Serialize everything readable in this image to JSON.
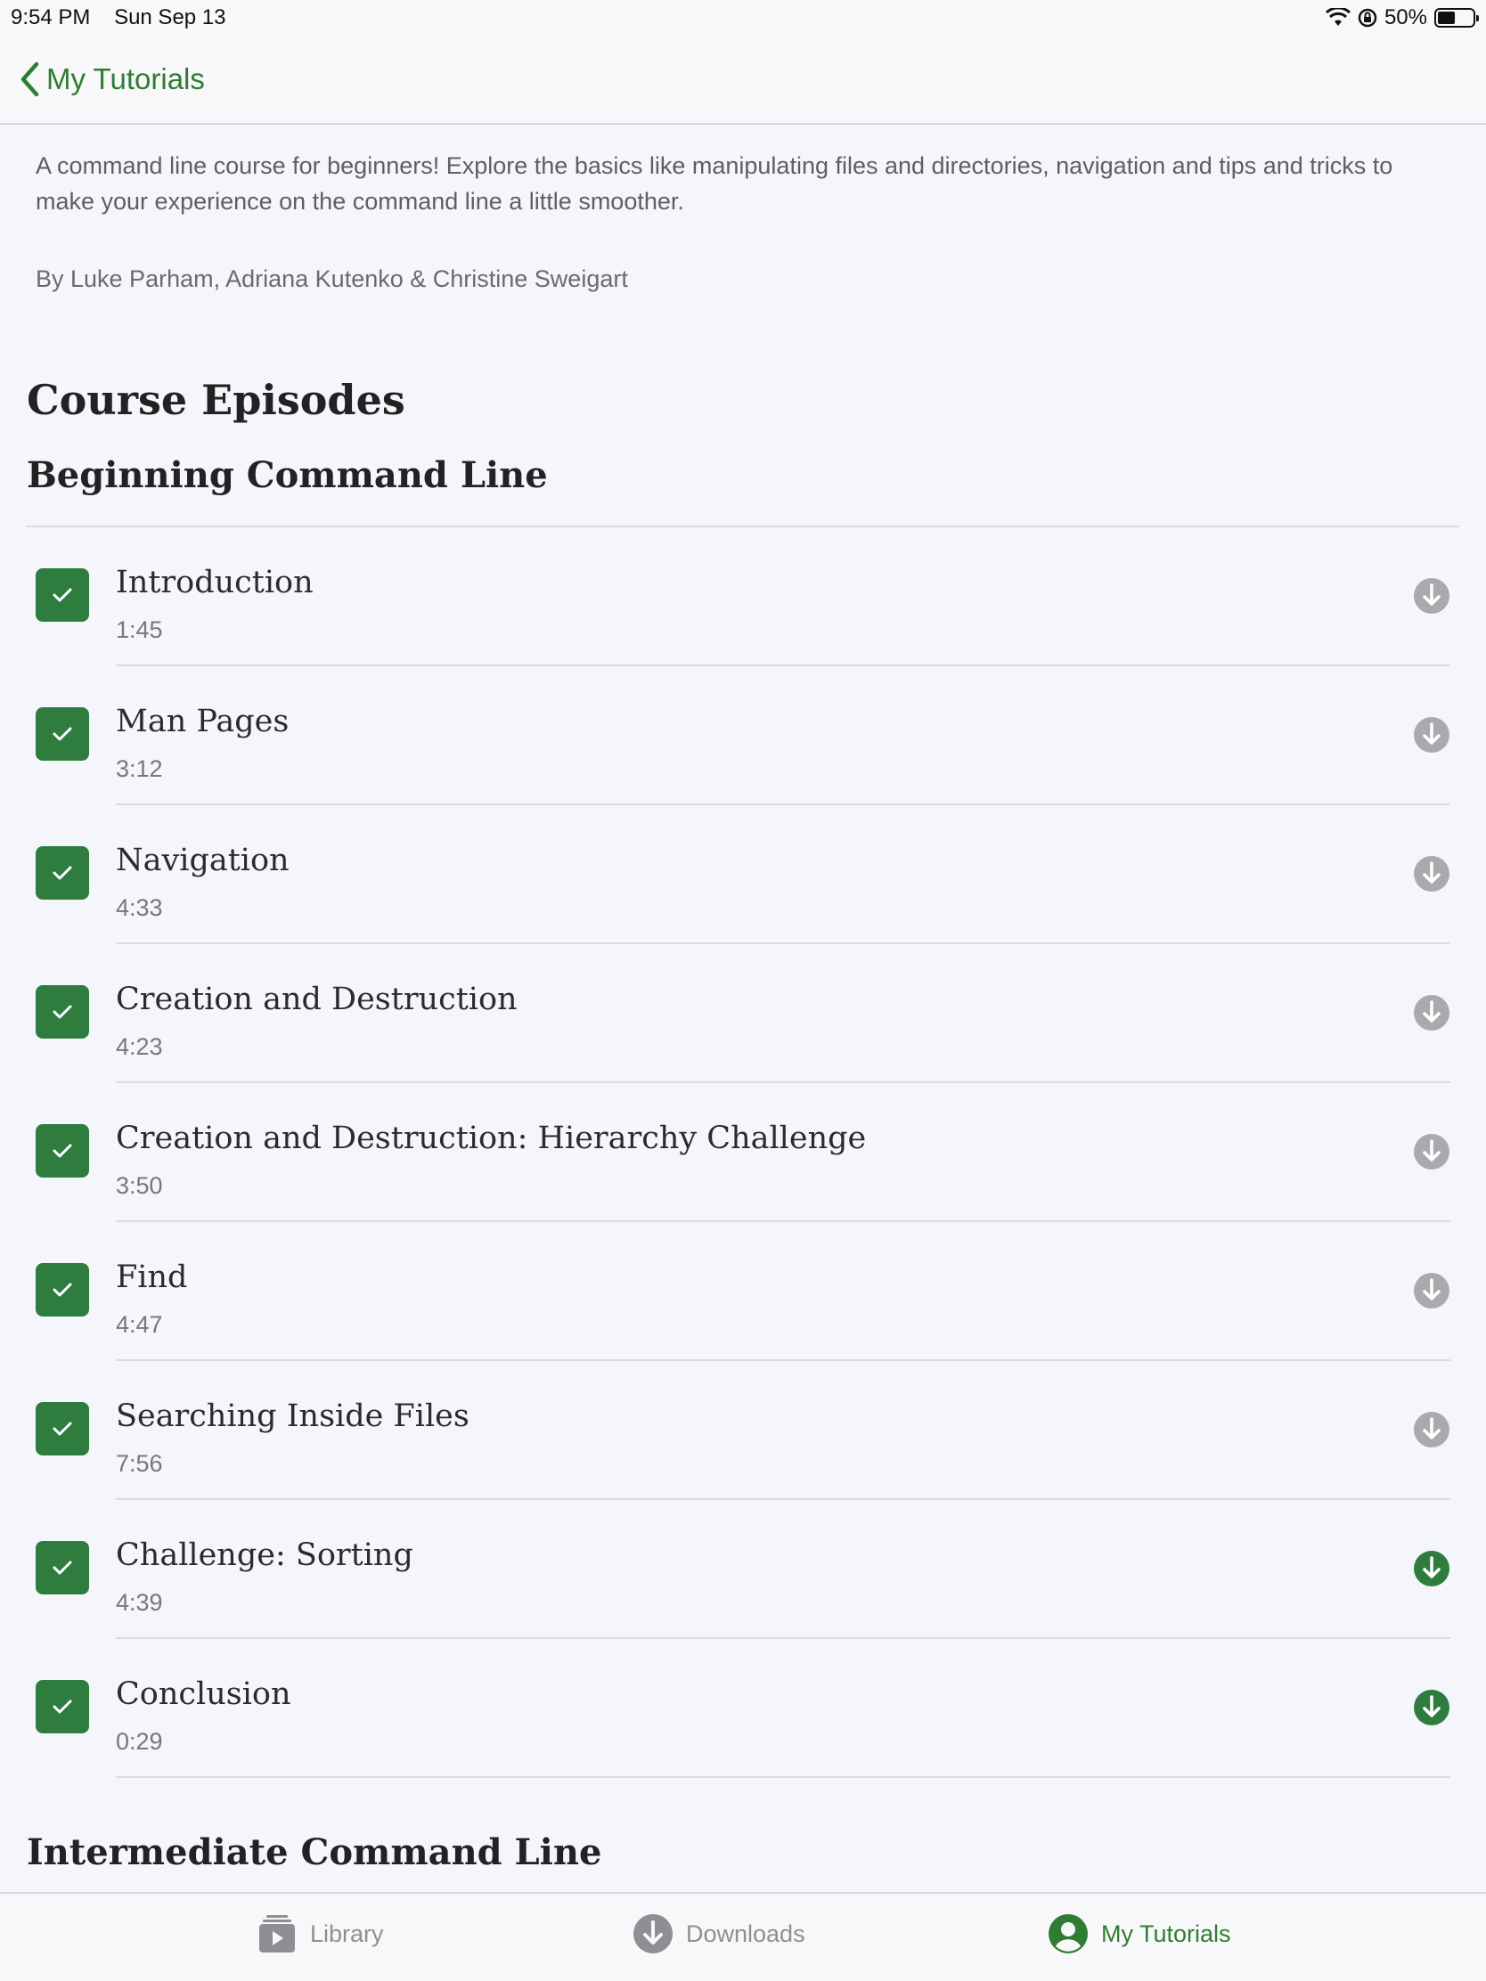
{
  "status_bar": {
    "time": "9:54 PM",
    "date": "Sun Sep 13",
    "battery": "50%",
    "battery_level": 0.5
  },
  "nav": {
    "back_label": "My Tutorials"
  },
  "course": {
    "description": "A command line course for beginners! Explore the basics like manipulating files and directories, navigation and tips and tricks to make your experience on the command line a little smoother.",
    "authors": "By Luke Parham, Adriana Kutenko & Christine Sweigart",
    "section_title": "Course Episodes"
  },
  "groups": [
    {
      "title": "Beginning Command Line",
      "episodes": [
        {
          "title": "Introduction",
          "duration": "1:45",
          "completed": true,
          "downloaded": false
        },
        {
          "title": "Man Pages",
          "duration": "3:12",
          "completed": true,
          "downloaded": false
        },
        {
          "title": "Navigation",
          "duration": "4:33",
          "completed": true,
          "downloaded": false
        },
        {
          "title": "Creation and Destruction",
          "duration": "4:23",
          "completed": true,
          "downloaded": false
        },
        {
          "title": "Creation and Destruction: Hierarchy Challenge",
          "duration": "3:50",
          "completed": true,
          "downloaded": false
        },
        {
          "title": "Find",
          "duration": "4:47",
          "completed": true,
          "downloaded": false
        },
        {
          "title": "Searching Inside Files",
          "duration": "7:56",
          "completed": true,
          "downloaded": false
        },
        {
          "title": "Challenge: Sorting",
          "duration": "4:39",
          "completed": true,
          "downloaded": true
        },
        {
          "title": "Conclusion",
          "duration": "0:29",
          "completed": true,
          "downloaded": true
        }
      ]
    },
    {
      "title": "Intermediate Command Line",
      "episodes": []
    }
  ],
  "colors": {
    "accent": "#2f7d32",
    "download_inactive": "#a9a9ae",
    "download_active": "#2f7d3e"
  },
  "tab_bar": {
    "tabs": [
      {
        "label": "Library",
        "icon": "library-icon",
        "active": false
      },
      {
        "label": "Downloads",
        "icon": "download-icon",
        "active": false
      },
      {
        "label": "My Tutorials",
        "icon": "profile-icon",
        "active": true
      }
    ]
  }
}
